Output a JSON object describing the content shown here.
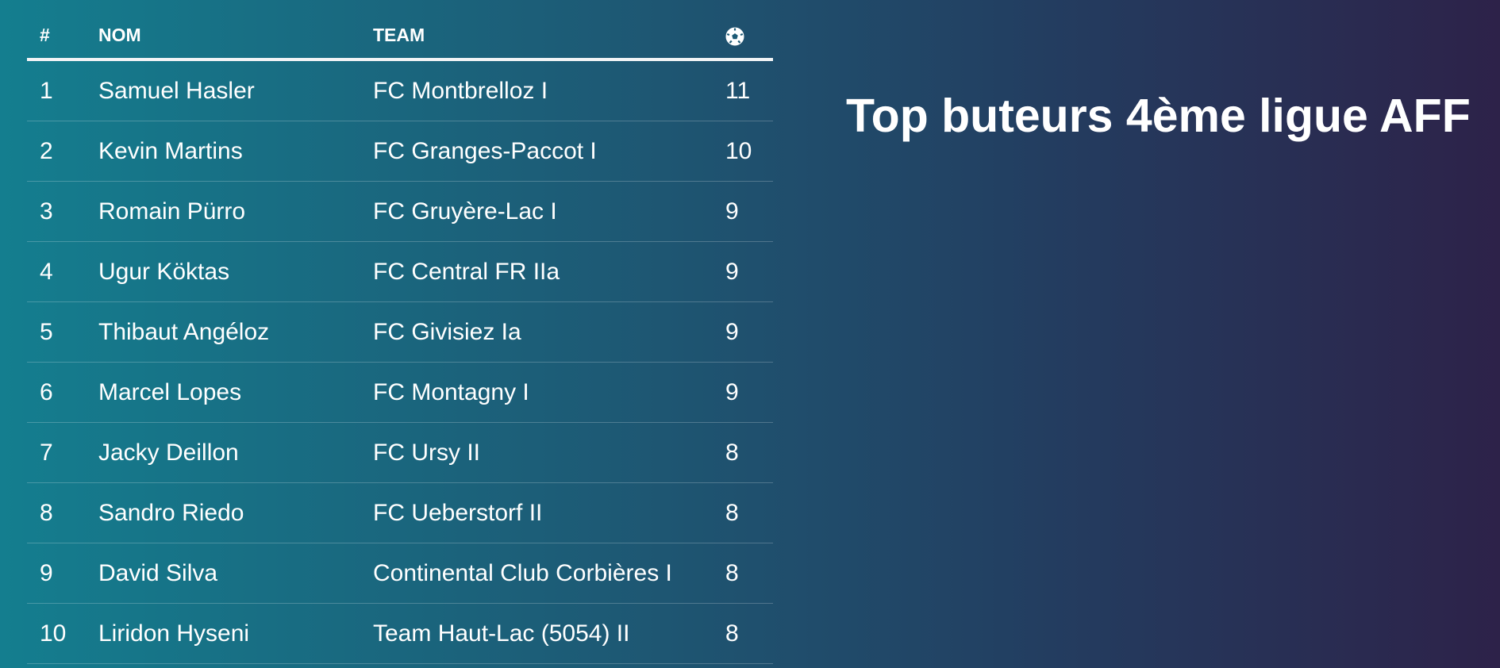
{
  "title": "Top buteurs 4ème ligue AFF",
  "table": {
    "headers": {
      "rank": "#",
      "name": "NOM",
      "team": "TEAM",
      "goals_icon": "soccer-ball-icon"
    },
    "rows": [
      {
        "rank": "1",
        "name": "Samuel Hasler",
        "team": "FC Montbrelloz I",
        "goals": "11"
      },
      {
        "rank": "2",
        "name": "Kevin Martins",
        "team": "FC Granges-Paccot I",
        "goals": "10"
      },
      {
        "rank": "3",
        "name": "Romain Pürro",
        "team": "FC Gruyère-Lac I",
        "goals": "9"
      },
      {
        "rank": "4",
        "name": "Ugur Köktas",
        "team": "FC Central FR IIa",
        "goals": "9"
      },
      {
        "rank": "5",
        "name": "Thibaut Angéloz",
        "team": "FC Givisiez Ia",
        "goals": "9"
      },
      {
        "rank": "6",
        "name": "Marcel Lopes",
        "team": "FC Montagny I",
        "goals": "9"
      },
      {
        "rank": "7",
        "name": "Jacky Deillon",
        "team": "FC Ursy II",
        "goals": "8"
      },
      {
        "rank": "8",
        "name": "Sandro Riedo",
        "team": "FC Ueberstorf II",
        "goals": "8"
      },
      {
        "rank": "9",
        "name": "David Silva",
        "team": "Continental Club Corbières I",
        "goals": "8"
      },
      {
        "rank": "10",
        "name": "Liridon Hyseni",
        "team": "Team Haut-Lac (5054) II",
        "goals": "8"
      }
    ]
  },
  "colors": {
    "gradient_start": "#147e8f",
    "gradient_end": "#2d2249",
    "text": "#ffffff"
  }
}
